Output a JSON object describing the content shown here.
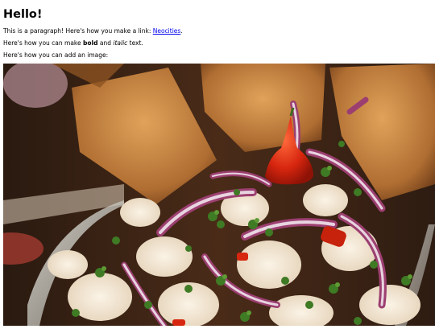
{
  "heading": "Hello!",
  "paragraph1": {
    "before_link": "This is a paragraph! Here's how you make a link: ",
    "link_text": "Neocities",
    "after_link": "."
  },
  "paragraph2": {
    "before_bold": "Here's how you can make ",
    "bold_text": "bold",
    "between": " and ",
    "italic_text": "italic",
    "after": " text."
  },
  "paragraph3": "Here's how you can add an image:",
  "image": {
    "subject": "ceviche-dish-photo",
    "colors": {
      "background_dark": "#3a2416",
      "chip": "#c9873f",
      "fish": "#f2e6d4",
      "onion": "#9c3f70",
      "cilantro": "#3f7a24",
      "pepper": "#d7260f"
    }
  }
}
